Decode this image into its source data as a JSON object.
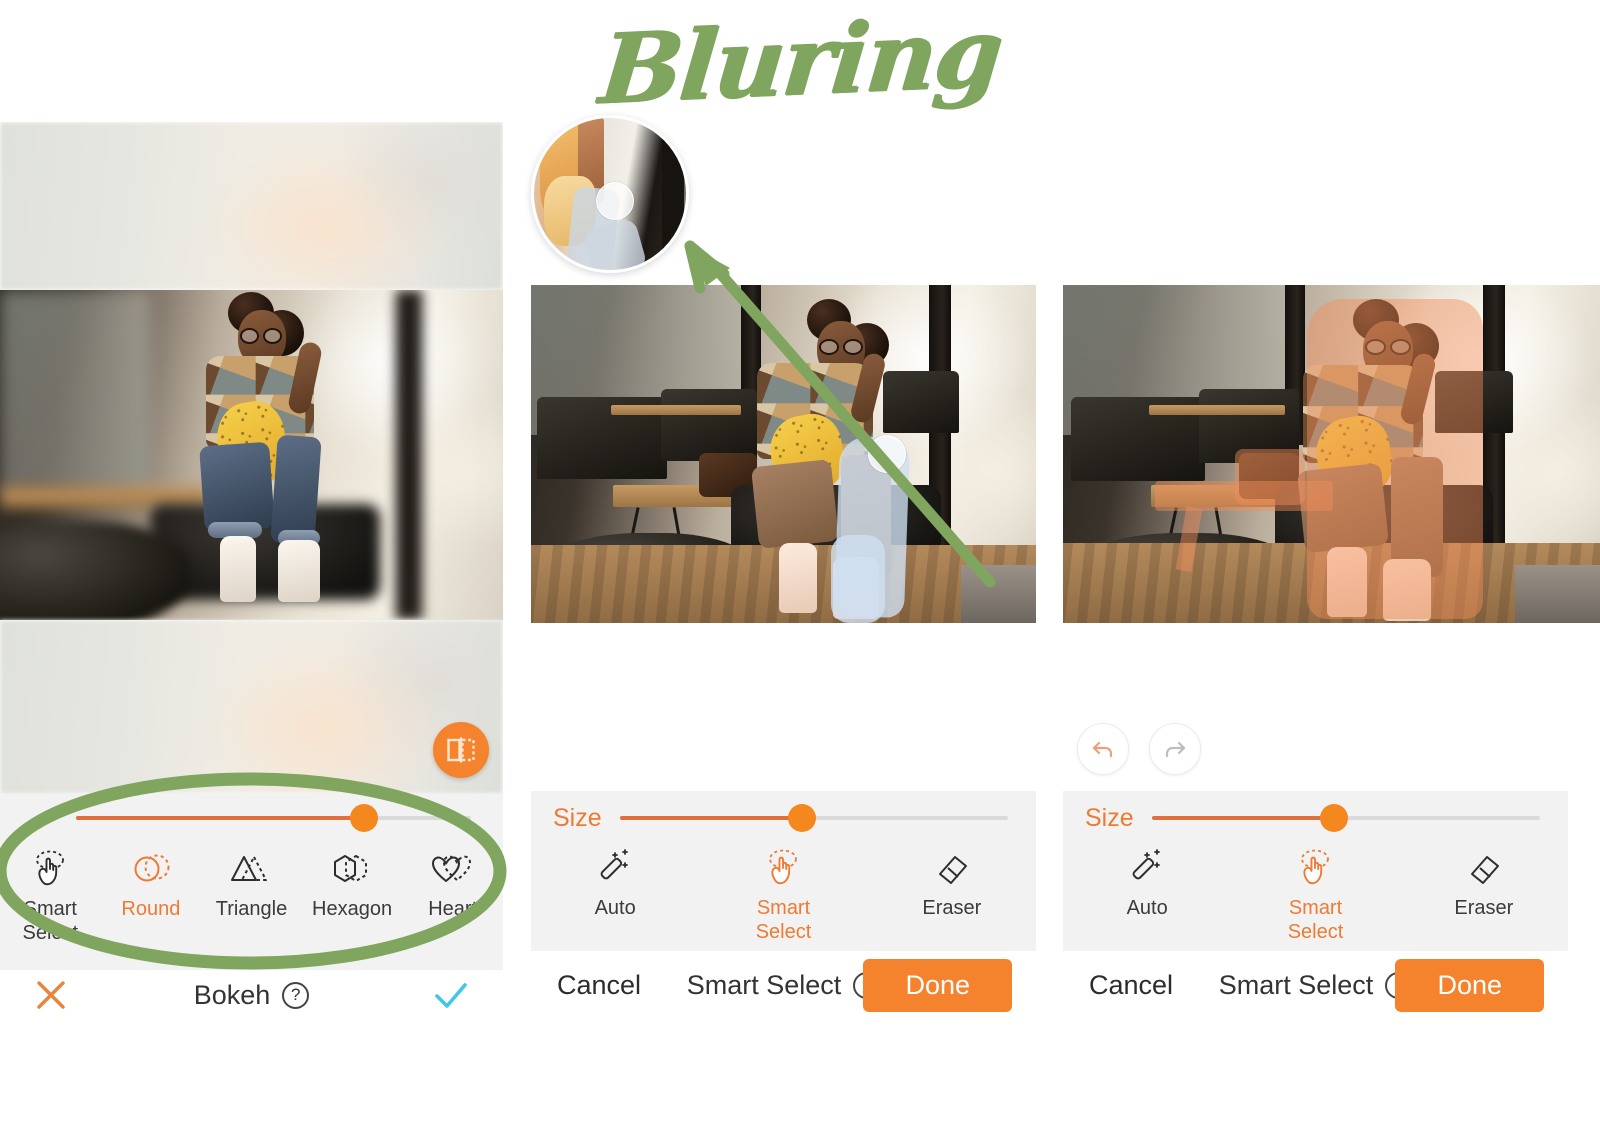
{
  "page": {
    "title": "Bluring",
    "accent_orange": "#F5822D",
    "accent_orange_dark": "#ED7B34",
    "annotation_green": "#7FA55E",
    "check_cyan": "#3FC6E8",
    "toolbar_bg": "#F2F2F2"
  },
  "annotations": {
    "title_text": "Bluring",
    "highlight_ellipse": "green-ellipse-highlight",
    "arrow": "green-arrow-pointing-to-magnifier",
    "magnifier": "zoom-loupe-preview"
  },
  "panel1": {
    "name": "Bokeh shape panel",
    "compare_button_icon": "compare-split-icon",
    "slider": {
      "label": "",
      "value_percent": 73,
      "min": 0,
      "max": 100
    },
    "shapes": [
      {
        "id": "smart-select",
        "label": "Smart\nSelect",
        "icon": "hand-tap-icon",
        "active": false
      },
      {
        "id": "round",
        "label": "Round",
        "icon": "two-circles-icon",
        "active": true
      },
      {
        "id": "triangle",
        "label": "Triangle",
        "icon": "two-triangles-icon",
        "active": false
      },
      {
        "id": "hexagon",
        "label": "Hexagon",
        "icon": "two-hexagons-icon",
        "active": false
      },
      {
        "id": "heart",
        "label": "Heart",
        "icon": "two-hearts-icon",
        "active": false
      }
    ],
    "bottom": {
      "cancel_icon": "close-x-icon",
      "title": "Bokeh",
      "help_icon": "question-mark-icon",
      "help_label": "?",
      "confirm_icon": "checkmark-icon"
    }
  },
  "panel2": {
    "name": "Smart Select editing panel",
    "slider": {
      "label": "Size",
      "value_percent": 47,
      "min": 0,
      "max": 100
    },
    "tools": [
      {
        "id": "auto",
        "label": "Auto",
        "icon": "magic-wand-icon",
        "active": false
      },
      {
        "id": "smart-select",
        "label": "Smart\nSelect",
        "icon": "hand-tap-icon",
        "active": true
      },
      {
        "id": "eraser",
        "label": "Eraser",
        "icon": "eraser-icon",
        "active": false
      }
    ],
    "bottom": {
      "cancel_label": "Cancel",
      "title": "Smart Select",
      "help_label": "?",
      "done_label": "Done"
    }
  },
  "panel3": {
    "name": "Smart Select result panel",
    "history": [
      {
        "id": "undo",
        "icon": "undo-arrow-icon",
        "enabled": true
      },
      {
        "id": "redo",
        "icon": "redo-arrow-icon",
        "enabled": false
      }
    ],
    "slider": {
      "label": "Size",
      "value_percent": 47,
      "min": 0,
      "max": 100
    },
    "tools": [
      {
        "id": "auto",
        "label": "Auto",
        "icon": "magic-wand-icon",
        "active": false
      },
      {
        "id": "smart-select",
        "label": "Smart\nSelect",
        "icon": "hand-tap-icon",
        "active": true
      },
      {
        "id": "eraser",
        "label": "Eraser",
        "icon": "eraser-icon",
        "active": false
      }
    ],
    "bottom": {
      "cancel_label": "Cancel",
      "title": "Smart Select",
      "help_label": "?",
      "done_label": "Done"
    }
  }
}
